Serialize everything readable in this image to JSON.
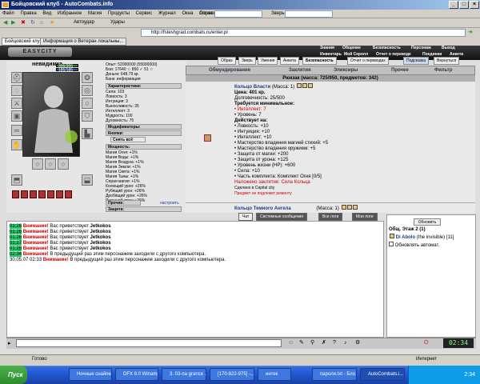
{
  "window": {
    "title": "Бойцовский клуб - AutoCombats.info"
  },
  "menu": {
    "items": [
      "Файл",
      "Правка",
      "Вид",
      "Избранное",
      "Магия",
      "Продукты",
      "Сервис",
      "Журнал",
      "Окна",
      "Справка"
    ],
    "login_label": "Логин:",
    "animal_label": "Зверь:"
  },
  "toolbar": {
    "autofill": "Автоудар",
    "cheats": "Удары"
  },
  "address": {
    "url": "http://fsteshgrad.combats.ru/enter.pl"
  },
  "browser_tabs": [
    "Бойцовский клуб",
    "Информация о Ветеран локальны..."
  ],
  "site": {
    "logo": "EASYCITY",
    "nav_top": [
      "Знания",
      "Общение",
      "Безопасность",
      "Персонаж",
      "Выход"
    ],
    "nav_sub": [
      "Инвентарь",
      "Мой Скролл",
      "Отчет о переводе",
      "Поединки",
      "Анкета"
    ]
  },
  "character": {
    "name": "невидимка",
    "hp": "306/306",
    "mp": "185/185",
    "stats_top": [
      "Опыт: 52000000 (55000000)",
      "Бои:  17640 ☆  850 ✓  51 ☆",
      "Деньги: 648.79 кр.",
      "Банк: информация"
    ],
    "characteristics_label": "Характеристики:",
    "characteristics": [
      "Сила: 103",
      "Ловкость: 3",
      "Интуиция: 3",
      "Выносливость: 35",
      "Интеллект: 3",
      "Мудрость: 100",
      "Духовность: 75"
    ],
    "modifiers_label": "Модификаторы:",
    "buttons_label": "Кнопки:",
    "remove_all": "Снять всё",
    "mastery_label": "Мощность:",
    "mastery": [
      "Магия Огня: +1%",
      "Магия Воды: +1%",
      "Магия Воздуха: +1%",
      "Магия Земли: +1%",
      "Магия Света: +1%",
      "Магия Тьмы: +1%",
      "Серая магия: +1%",
      "Колющий урон: +26%",
      "Рубящий урон: +26%",
      "Дробящий урон: +26%",
      "Режущий урон: +26%"
    ],
    "misc_label": "Прочие:",
    "settings_label": "настроить",
    "protection_label": "Защита:"
  },
  "inventory": {
    "tabs": [
      "Образ",
      "Зверь",
      "Умения",
      "Анкета",
      "Безопасность",
      "Отчет о переводах",
      "Подсказка",
      "Вернуться"
    ],
    "categories": [
      "Обмундирование",
      "Заклятия",
      "Эликсиры",
      "Прочее",
      "Фильтр"
    ],
    "backpack": "Рюкзак (масса: 725/950, предметов: 342)",
    "item1": {
      "name": "Кольцо Власти",
      "mass": "(Масса: 1)",
      "price": "Цена: 401 кр.",
      "durability": "Долговечность: 25/500",
      "requirements_label": "Требуется минимальное:",
      "requirements": [
        "• Интеллект: 7",
        "• Уровень: 7"
      ],
      "effects_label": "Действует на:",
      "effects": [
        "• Ловкость: +10",
        "• Интуиция: +10",
        "• Интеллект: +10",
        "• Мастерство владения магией стихий: +5",
        "• Мастерство владения оружием: +5",
        "• Защита от магии: +200",
        "• Защита от урона: +125",
        "• Уровень жизни (HP): +600",
        "• Сила: +10",
        "• Часть комплекта: Комплект Огня [0/5]"
      ],
      "enchant": "Наложено заклятие: Сила Кольца",
      "bound": "Сделано в Capital city",
      "note": "Предмет не подлежит ремонту"
    },
    "item2": {
      "name": "Кольцо Темного Ангела",
      "mass": "(Масса: 1)"
    }
  },
  "chat": {
    "tabs": [
      "Чат",
      "Системные сообщения",
      "Все логи",
      "Мои логи"
    ],
    "lines": [
      {
        "time": "01:26",
        "warn": "Внимание!",
        "text": "Вас приветствует",
        "nick": "Jetkokos"
      },
      {
        "time": "01:26",
        "warn": "Внимание!",
        "text": "Вас приветствует",
        "nick": "Jetkokos"
      },
      {
        "time": "01:26",
        "warn": "Внимание!",
        "text": "Вас приветствует",
        "nick": "Jetkokos"
      },
      {
        "time": "01:27",
        "warn": "Внимание!",
        "text": "Вас приветствует",
        "nick": "Jetkokos"
      },
      {
        "time": "01:28",
        "warn": "Внимание!",
        "text": "Вас приветствует",
        "nick": "Jetkokos"
      },
      {
        "time": "02:34",
        "warn": "Внимание!",
        "text": "В предыдущий раз этим персонажем заходили с другого компьютера.",
        "nick": ""
      },
      {
        "time": "30.05.07 02:33",
        "warn": "Внимание!",
        "text": "В предыдущий раз этим персонажем заходили с другого компьютера.",
        "nick": ""
      }
    ]
  },
  "online": {
    "refresh": "Обновить",
    "location": "Общ. Этаж 2 (1)",
    "user": "Di Abolo",
    "user_status": "(the invisible)",
    "user_level": "[11]",
    "auto_refresh": "Обновлять автомат."
  },
  "clock": "02:34",
  "status": {
    "text": "Готово",
    "zone": "Интернет"
  },
  "taskbar": {
    "start": "Пуск",
    "tasks": [
      "Ночные снайперы",
      "DFX 8.0 Winamp",
      "3. 03-na grance ...",
      "[170-822-975] -...",
      "интек",
      "пароли.txt - Бло...",
      "AutoCombats.i..."
    ],
    "time": "2:34"
  }
}
